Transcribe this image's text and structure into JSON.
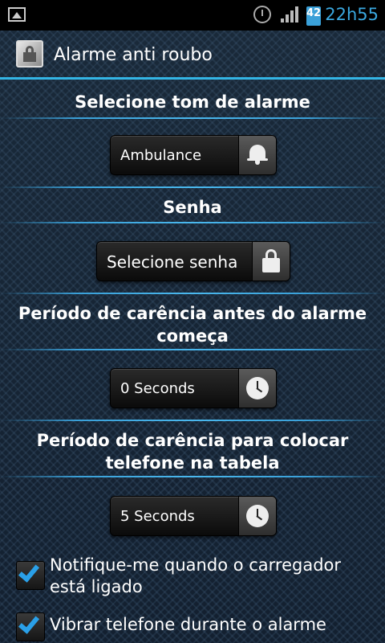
{
  "status_bar": {
    "battery": "42",
    "time": "22h55"
  },
  "app": {
    "title": "Alarme anti roubo"
  },
  "sections": {
    "tone": {
      "header": "Selecione tom de alarme",
      "value": "Ambulance"
    },
    "password": {
      "header": "Senha",
      "value": "Selecione senha"
    },
    "grace_before": {
      "header": "Período de carência antes do alarme começa",
      "value": "0 Seconds"
    },
    "grace_place": {
      "header": "Período de carência para colocar telefone na tabela",
      "value": "5 Seconds"
    }
  },
  "checkboxes": [
    {
      "label": "Notifique-me quando o carregador está ligado",
      "checked": true
    },
    {
      "label": "Vibrar telefone durante o alarme",
      "checked": true
    }
  ],
  "colors": {
    "accent": "#33b5e5",
    "check": "#2aa0e8",
    "time": "#3aa8e0"
  }
}
